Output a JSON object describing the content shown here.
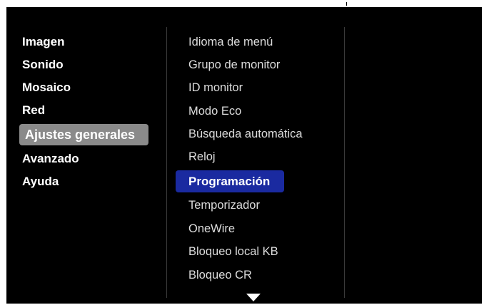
{
  "menu": {
    "categories": [
      {
        "label": "Imagen"
      },
      {
        "label": "Sonido"
      },
      {
        "label": "Mosaico"
      },
      {
        "label": "Red"
      },
      {
        "label": "Ajustes generales"
      },
      {
        "label": "Avanzado"
      },
      {
        "label": "Ayuda"
      }
    ],
    "selected_category": "Ajustes generales",
    "submenu_items": [
      {
        "label": "Idioma de menú"
      },
      {
        "label": "Grupo de monitor"
      },
      {
        "label": "ID monitor"
      },
      {
        "label": "Modo Eco"
      },
      {
        "label": "Búsqueda automática"
      },
      {
        "label": "Reloj"
      },
      {
        "label": "Programación"
      },
      {
        "label": "Temporizador"
      },
      {
        "label": "OneWire"
      },
      {
        "label": "Bloqueo local KB"
      },
      {
        "label": "Bloqueo CR"
      }
    ],
    "selected_submenu_item": "Programación",
    "scroll_indicator": "chevron-down-icon"
  },
  "colors": {
    "background": "#000000",
    "category_highlight": "#8a8a8a",
    "submenu_highlight": "#1a2aa0",
    "text": "#ffffff"
  }
}
